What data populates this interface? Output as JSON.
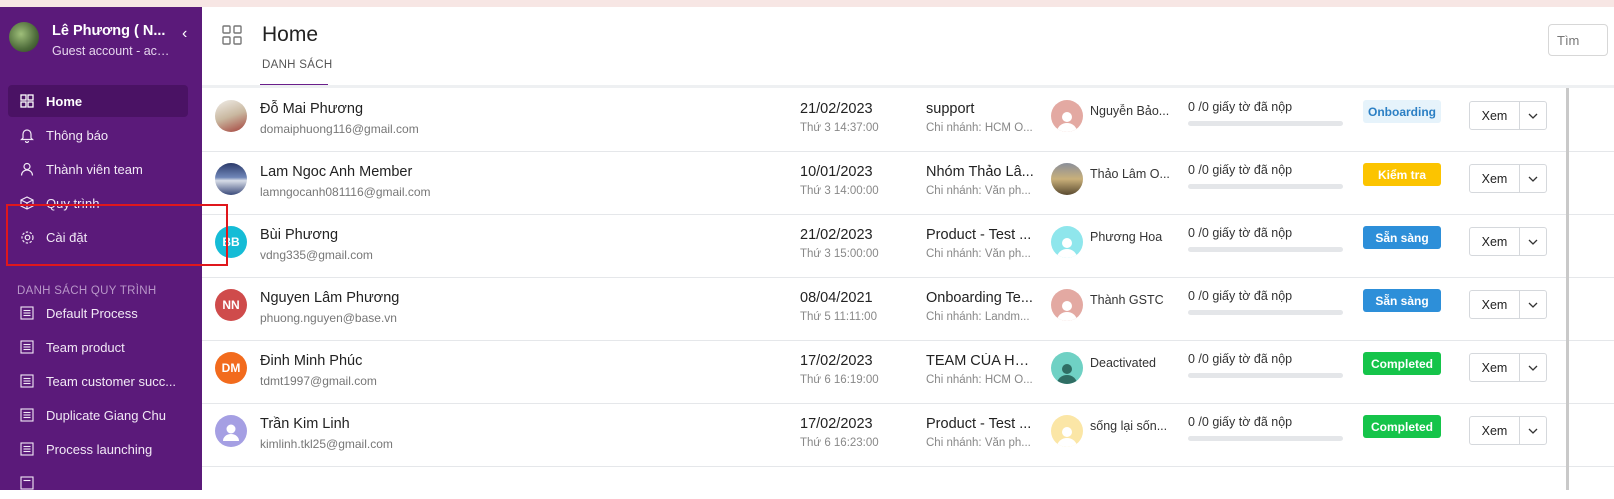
{
  "user": {
    "name": "Lê Phương ( N...",
    "role": "Guest account - accou..."
  },
  "nav": [
    {
      "label": "Home",
      "icon": "grid-icon",
      "active": true
    },
    {
      "label": "Thông báo",
      "icon": "bell-icon"
    },
    {
      "label": "Thành viên team",
      "icon": "user-icon"
    },
    {
      "label": "Quy trình",
      "icon": "cube-icon"
    },
    {
      "label": "Cài đặt",
      "icon": "gear-icon"
    }
  ],
  "section_title": "DANH SÁCH QUY TRÌNH",
  "processes": [
    {
      "label": "Default Process",
      "icon": "list-icon"
    },
    {
      "label": "Team product",
      "icon": "list-icon"
    },
    {
      "label": "Team customer succ...",
      "icon": "list-icon"
    },
    {
      "label": "Duplicate Giang Chu",
      "icon": "list-icon"
    },
    {
      "label": "Process launching",
      "icon": "list-icon"
    }
  ],
  "header": {
    "title": "Home",
    "tab": "DANH SÁCH",
    "search_placeholder": "Tìm"
  },
  "rows": [
    {
      "initials": "",
      "name": "Đỗ Mai Phương",
      "email": "domaiphuong116@gmail.com",
      "date": "21/02/2023",
      "time": "Thứ 3 14:37:00",
      "process": "support",
      "branch": "Chi nhánh: HCM O...",
      "owner": "Nguyễn Bảo...",
      "docs": "0 /0 giấy tờ đã nộp",
      "progress": 0,
      "status": "Onboarding",
      "view": "Xem"
    },
    {
      "initials": "",
      "name": "Lam Ngoc Anh Member",
      "email": "lamngocanh081116@gmail.com",
      "date": "10/01/2023",
      "time": "Thứ 3 14:00:00",
      "process": "Nhóm Thảo Lâ...",
      "branch": "Chi nhánh: Văn ph...",
      "owner": "Thảo Lâm O...",
      "docs": "0 /0 giấy tờ đã nộp",
      "progress": 0,
      "status": "Kiểm tra",
      "view": "Xem"
    },
    {
      "initials": "BB",
      "name": "Bùi Phương",
      "email": "vdng335@gmail.com",
      "date": "21/02/2023",
      "time": "Thứ 3 15:00:00",
      "process": "Product - Test ...",
      "branch": "Chi nhánh: Văn ph...",
      "owner": "Phương Hoa",
      "docs": "0 /0 giấy tờ đã nộp",
      "progress": 0,
      "status": "Sẵn sàng",
      "view": "Xem"
    },
    {
      "initials": "NN",
      "name": "Nguyen Lâm Phương",
      "email": "phuong.nguyen@base.vn",
      "date": "08/04/2021",
      "time": "Thứ 5 11:11:00",
      "process": "Onboarding Te...",
      "branch": "Chi nhánh: Landm...",
      "owner": "Thành GSTC",
      "docs": "0 /0 giấy tờ đã nộp",
      "progress": 0,
      "status": "Sẵn sàng",
      "view": "Xem"
    },
    {
      "initials": "DM",
      "name": "Đinh Minh Phúc",
      "email": "tdmt1997@gmail.com",
      "date": "17/02/2023",
      "time": "Thứ 6 16:19:00",
      "process": "TEAM CỦA HO...",
      "branch": "Chi nhánh: HCM O...",
      "owner": "Deactivated",
      "docs": "0 /0 giấy tờ đã nộp",
      "progress": 0,
      "status": "Completed",
      "view": "Xem"
    },
    {
      "initials": "",
      "name": "Trần Kim Linh",
      "email": "kimlinh.tkl25@gmail.com",
      "date": "17/02/2023",
      "time": "Thứ 6 16:23:00",
      "process": "Product - Test ...",
      "branch": "Chi nhánh: Văn ph...",
      "owner": "sống lại sốn...",
      "docs": "0 /0 giấy tờ đã nộp",
      "progress": 0,
      "status": "Completed",
      "view": "Xem"
    }
  ],
  "colors": {
    "sidebar": "#5b1a7a",
    "accent": "#6a1f8b",
    "onboarding_bg": "#e6f3fb",
    "onboarding_fg": "#2b7fc4",
    "kiemtra": "#fcc400",
    "sansang": "#2d8fd9",
    "completed": "#15c44a",
    "highlight": "#e0171c"
  }
}
